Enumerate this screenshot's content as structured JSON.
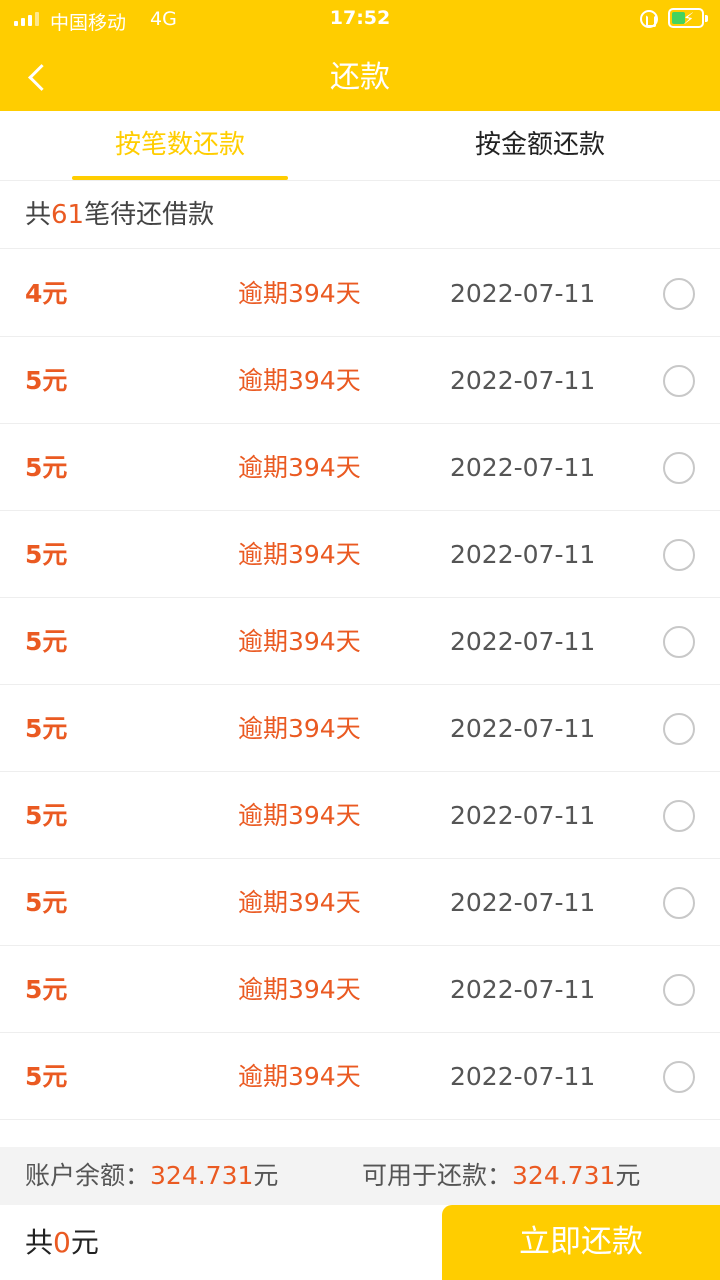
{
  "status_bar": {
    "carrier": "中国移动",
    "network": "4G",
    "time": "17:52"
  },
  "header": {
    "title": "还款"
  },
  "tabs": [
    {
      "label": "按笔数还款",
      "active": true
    },
    {
      "label": "按金额还款",
      "active": false
    }
  ],
  "summary": {
    "prefix": "共",
    "count": "61",
    "suffix": "笔待还借款"
  },
  "loans": [
    {
      "amount": "4元",
      "overdue": "逾期394天",
      "date": "2022-07-11"
    },
    {
      "amount": "5元",
      "overdue": "逾期394天",
      "date": "2022-07-11"
    },
    {
      "amount": "5元",
      "overdue": "逾期394天",
      "date": "2022-07-11"
    },
    {
      "amount": "5元",
      "overdue": "逾期394天",
      "date": "2022-07-11"
    },
    {
      "amount": "5元",
      "overdue": "逾期394天",
      "date": "2022-07-11"
    },
    {
      "amount": "5元",
      "overdue": "逾期394天",
      "date": "2022-07-11"
    },
    {
      "amount": "5元",
      "overdue": "逾期394天",
      "date": "2022-07-11"
    },
    {
      "amount": "5元",
      "overdue": "逾期394天",
      "date": "2022-07-11"
    },
    {
      "amount": "5元",
      "overdue": "逾期394天",
      "date": "2022-07-11"
    },
    {
      "amount": "5元",
      "overdue": "逾期394天",
      "date": "2022-07-11"
    }
  ],
  "balance": {
    "account_label": "账户余额：",
    "account_value": "324.731",
    "account_unit": "元",
    "available_label": "可用于还款：",
    "available_value": "324.731",
    "available_unit": "元"
  },
  "footer": {
    "total_prefix": "共",
    "total_value": "0",
    "total_unit": "元",
    "pay_label": "立即还款"
  },
  "colors": {
    "brand_yellow": "#ffcd00",
    "accent_orange": "#ea5a22"
  }
}
